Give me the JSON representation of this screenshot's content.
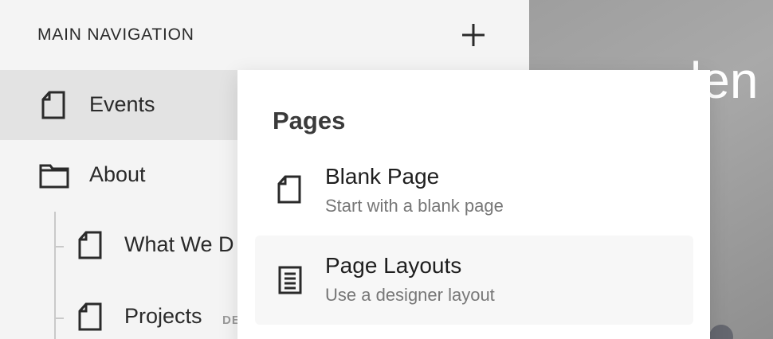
{
  "sidebar": {
    "title": "MAIN NAVIGATION",
    "items": [
      {
        "label": "Events",
        "icon": "page-icon"
      },
      {
        "label": "About",
        "icon": "folder-icon"
      },
      {
        "label": "What We D",
        "icon": "page-icon"
      },
      {
        "label": "Projects",
        "icon": "page-icon",
        "badge": "DE"
      }
    ]
  },
  "preview": {
    "text": "len"
  },
  "popup": {
    "title": "Pages",
    "options": [
      {
        "title": "Blank Page",
        "description": "Start with a blank page",
        "icon": "page-icon"
      },
      {
        "title": "Page Layouts",
        "description": "Use a designer layout",
        "icon": "layout-icon"
      }
    ]
  }
}
